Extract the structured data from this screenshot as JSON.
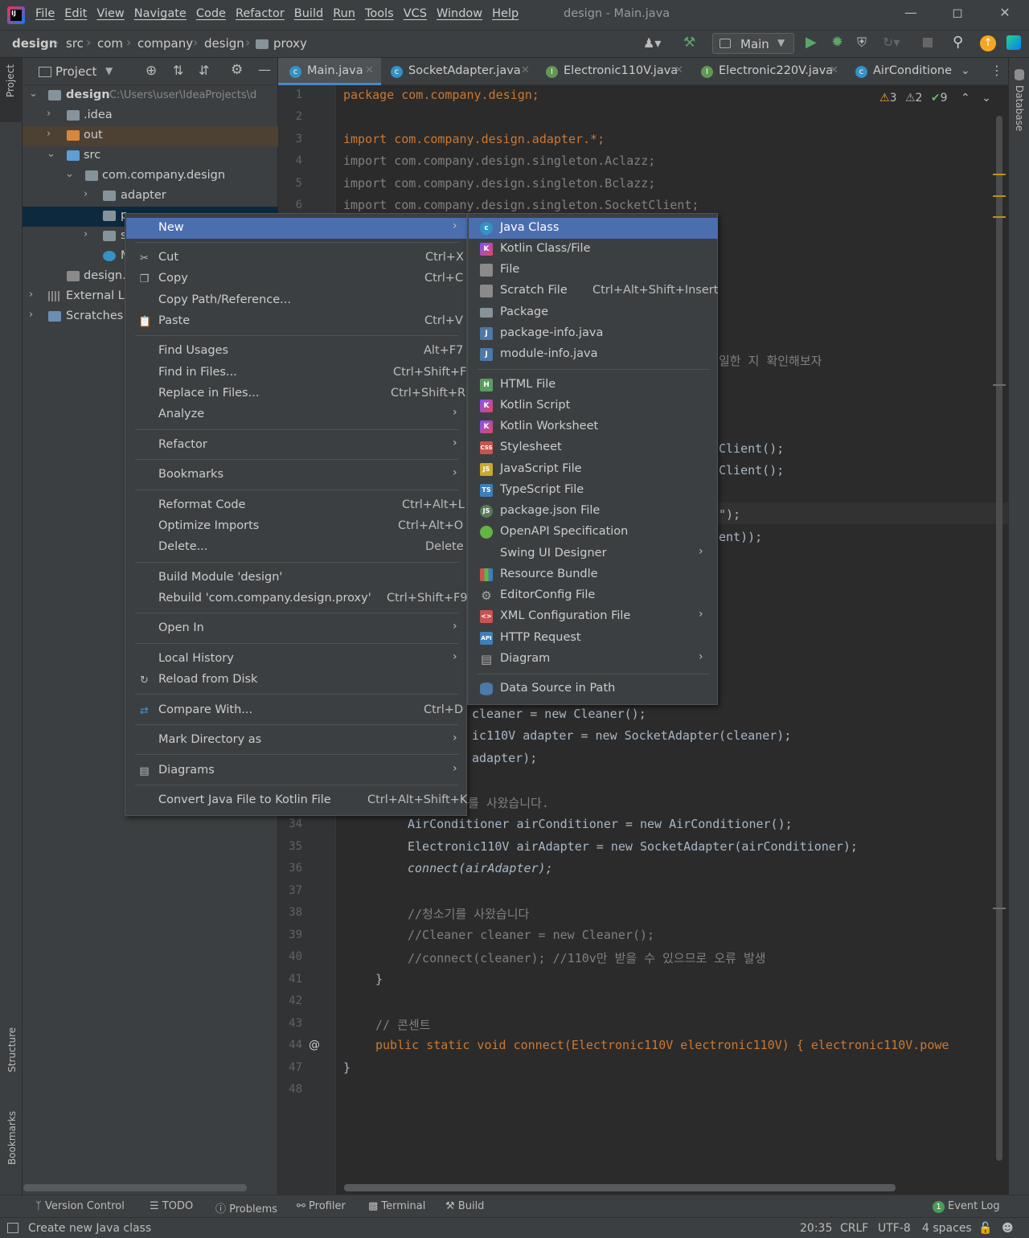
{
  "window": {
    "title": "design - Main.java",
    "menu": [
      "File",
      "Edit",
      "View",
      "Navigate",
      "Code",
      "Refactor",
      "Build",
      "Run",
      "Tools",
      "VCS",
      "Window",
      "Help"
    ]
  },
  "breadcrumb": [
    "design",
    "src",
    "com",
    "company",
    "design",
    "proxy"
  ],
  "run_config": "Main",
  "project_panel": {
    "title": "Project",
    "tree": [
      {
        "label": "design",
        "extra": "C:\\Users\\user\\IdeaProjects\\d",
        "bold": true
      },
      {
        "label": ".idea"
      },
      {
        "label": "out"
      },
      {
        "label": "src"
      },
      {
        "label": "com.company.design"
      },
      {
        "label": "adapter"
      },
      {
        "label": "p"
      },
      {
        "label": "s"
      },
      {
        "label": "M"
      },
      {
        "label": "design.i"
      },
      {
        "label": "External Lib"
      },
      {
        "label": "Scratches a"
      }
    ]
  },
  "tabs": [
    "Main.java",
    "SocketAdapter.java",
    "Electronic110V.java",
    "Electronic220V.java",
    "AirConditione"
  ],
  "inspections": {
    "warnings": "3",
    "weak_warnings": "2",
    "typos": "9"
  },
  "code_lines": [
    {
      "n": "1",
      "t": "package com.company.design;"
    },
    {
      "n": "2",
      "t": ""
    },
    {
      "n": "3",
      "t": "import com.company.design.adapter.*;"
    },
    {
      "n": "4",
      "t": "import com.company.design.singleton.Aclazz;"
    },
    {
      "n": "5",
      "t": "import com.company.design.singleton.Bclazz;"
    },
    {
      "n": "6",
      "t": "import com.company.design.singleton.SocketClient;"
    }
  ],
  "code_fragments": {
    "f1": "일한 지 확인해보자",
    "f2": "Client();",
    "f3": "Client();",
    "f4": "\");",
    "f5": "ent));",
    "f6": "cleaner = new Cleaner();",
    "f7": "ic110V adapter = new SocketAdapter(cleaner);",
    "f8": "adapter);",
    "f9": "를 사왔습니다."
  },
  "code_lower": [
    {
      "n": "34",
      "t": "AirConditioner airConditioner = new AirConditioner();"
    },
    {
      "n": "35",
      "t": "Electronic110V airAdapter = new SocketAdapter(airConditioner);"
    },
    {
      "n": "36",
      "t": "connect(airAdapter);"
    },
    {
      "n": "37",
      "t": ""
    },
    {
      "n": "38",
      "t": "//청소기를 사왔습니다"
    },
    {
      "n": "39",
      "t": "//Cleaner cleaner = new Cleaner();"
    },
    {
      "n": "40",
      "t": "//connect(cleaner); //110v만 받을 수 있으므로 오류 발생"
    },
    {
      "n": "41",
      "t": "}"
    },
    {
      "n": "42",
      "t": ""
    },
    {
      "n": "43",
      "t": "// 콘센트"
    },
    {
      "n": "44",
      "t": "public static void connect(Electronic110V electronic110V) { electronic110V.powe"
    },
    {
      "n": "47",
      "t": "}"
    },
    {
      "n": "48",
      "t": ""
    }
  ],
  "context_menu": {
    "items": [
      {
        "label": "New",
        "shortcut": "",
        "submenu": true
      },
      {
        "label": "Cut",
        "shortcut": "Ctrl+X"
      },
      {
        "label": "Copy",
        "shortcut": "Ctrl+C"
      },
      {
        "label": "Copy Path/Reference...",
        "shortcut": ""
      },
      {
        "label": "Paste",
        "shortcut": "Ctrl+V"
      },
      {
        "label": "Find Usages",
        "shortcut": "Alt+F7"
      },
      {
        "label": "Find in Files...",
        "shortcut": "Ctrl+Shift+F"
      },
      {
        "label": "Replace in Files...",
        "shortcut": "Ctrl+Shift+R"
      },
      {
        "label": "Analyze",
        "shortcut": ""
      },
      {
        "label": "Refactor",
        "shortcut": ""
      },
      {
        "label": "Bookmarks",
        "shortcut": ""
      },
      {
        "label": "Reformat Code",
        "shortcut": "Ctrl+Alt+L"
      },
      {
        "label": "Optimize Imports",
        "shortcut": "Ctrl+Alt+O"
      },
      {
        "label": "Delete...",
        "shortcut": "Delete"
      },
      {
        "label": "Build Module 'design'",
        "shortcut": ""
      },
      {
        "label": "Rebuild 'com.company.design.proxy'",
        "shortcut": "Ctrl+Shift+F9"
      },
      {
        "label": "Open In",
        "shortcut": ""
      },
      {
        "label": "Local History",
        "shortcut": ""
      },
      {
        "label": "Reload from Disk",
        "shortcut": ""
      },
      {
        "label": "Compare With...",
        "shortcut": "Ctrl+D"
      },
      {
        "label": "Mark Directory as",
        "shortcut": ""
      },
      {
        "label": "Diagrams",
        "shortcut": ""
      },
      {
        "label": "Convert Java File to Kotlin File",
        "shortcut": "Ctrl+Alt+Shift+K"
      }
    ]
  },
  "new_submenu": {
    "items": [
      {
        "label": "Java Class",
        "shortcut": ""
      },
      {
        "label": "Kotlin Class/File",
        "shortcut": ""
      },
      {
        "label": "File",
        "shortcut": ""
      },
      {
        "label": "Scratch File",
        "shortcut": "Ctrl+Alt+Shift+Insert"
      },
      {
        "label": "Package",
        "shortcut": ""
      },
      {
        "label": "package-info.java",
        "shortcut": ""
      },
      {
        "label": "module-info.java",
        "shortcut": ""
      },
      {
        "label": "HTML File",
        "shortcut": ""
      },
      {
        "label": "Kotlin Script",
        "shortcut": ""
      },
      {
        "label": "Kotlin Worksheet",
        "shortcut": ""
      },
      {
        "label": "Stylesheet",
        "shortcut": ""
      },
      {
        "label": "JavaScript File",
        "shortcut": ""
      },
      {
        "label": "TypeScript File",
        "shortcut": ""
      },
      {
        "label": "package.json File",
        "shortcut": ""
      },
      {
        "label": "OpenAPI Specification",
        "shortcut": ""
      },
      {
        "label": "Swing UI Designer",
        "shortcut": ""
      },
      {
        "label": "Resource Bundle",
        "shortcut": ""
      },
      {
        "label": "EditorConfig File",
        "shortcut": ""
      },
      {
        "label": "XML Configuration File",
        "shortcut": ""
      },
      {
        "label": "HTTP Request",
        "shortcut": ""
      },
      {
        "label": "Diagram",
        "shortcut": ""
      },
      {
        "label": "Data Source in Path",
        "shortcut": ""
      }
    ]
  },
  "side_tabs": {
    "project": "Project",
    "structure": "Structure",
    "bookmarks": "Bookmarks",
    "database": "Database"
  },
  "tool_windows": [
    "Version Control",
    "TODO",
    "Problems",
    "Profiler",
    "Terminal",
    "Build",
    "Event Log"
  ],
  "event_log_count": "1",
  "status": {
    "message": "Create new Java class",
    "position": "20:35",
    "line_ending": "CRLF",
    "encoding": "UTF-8",
    "indent": "4 spaces"
  },
  "colors": {
    "accent": "#4b6eaf",
    "background": "#2b2b2b",
    "panel": "#3c3f41",
    "keyword": "#cc7832"
  }
}
